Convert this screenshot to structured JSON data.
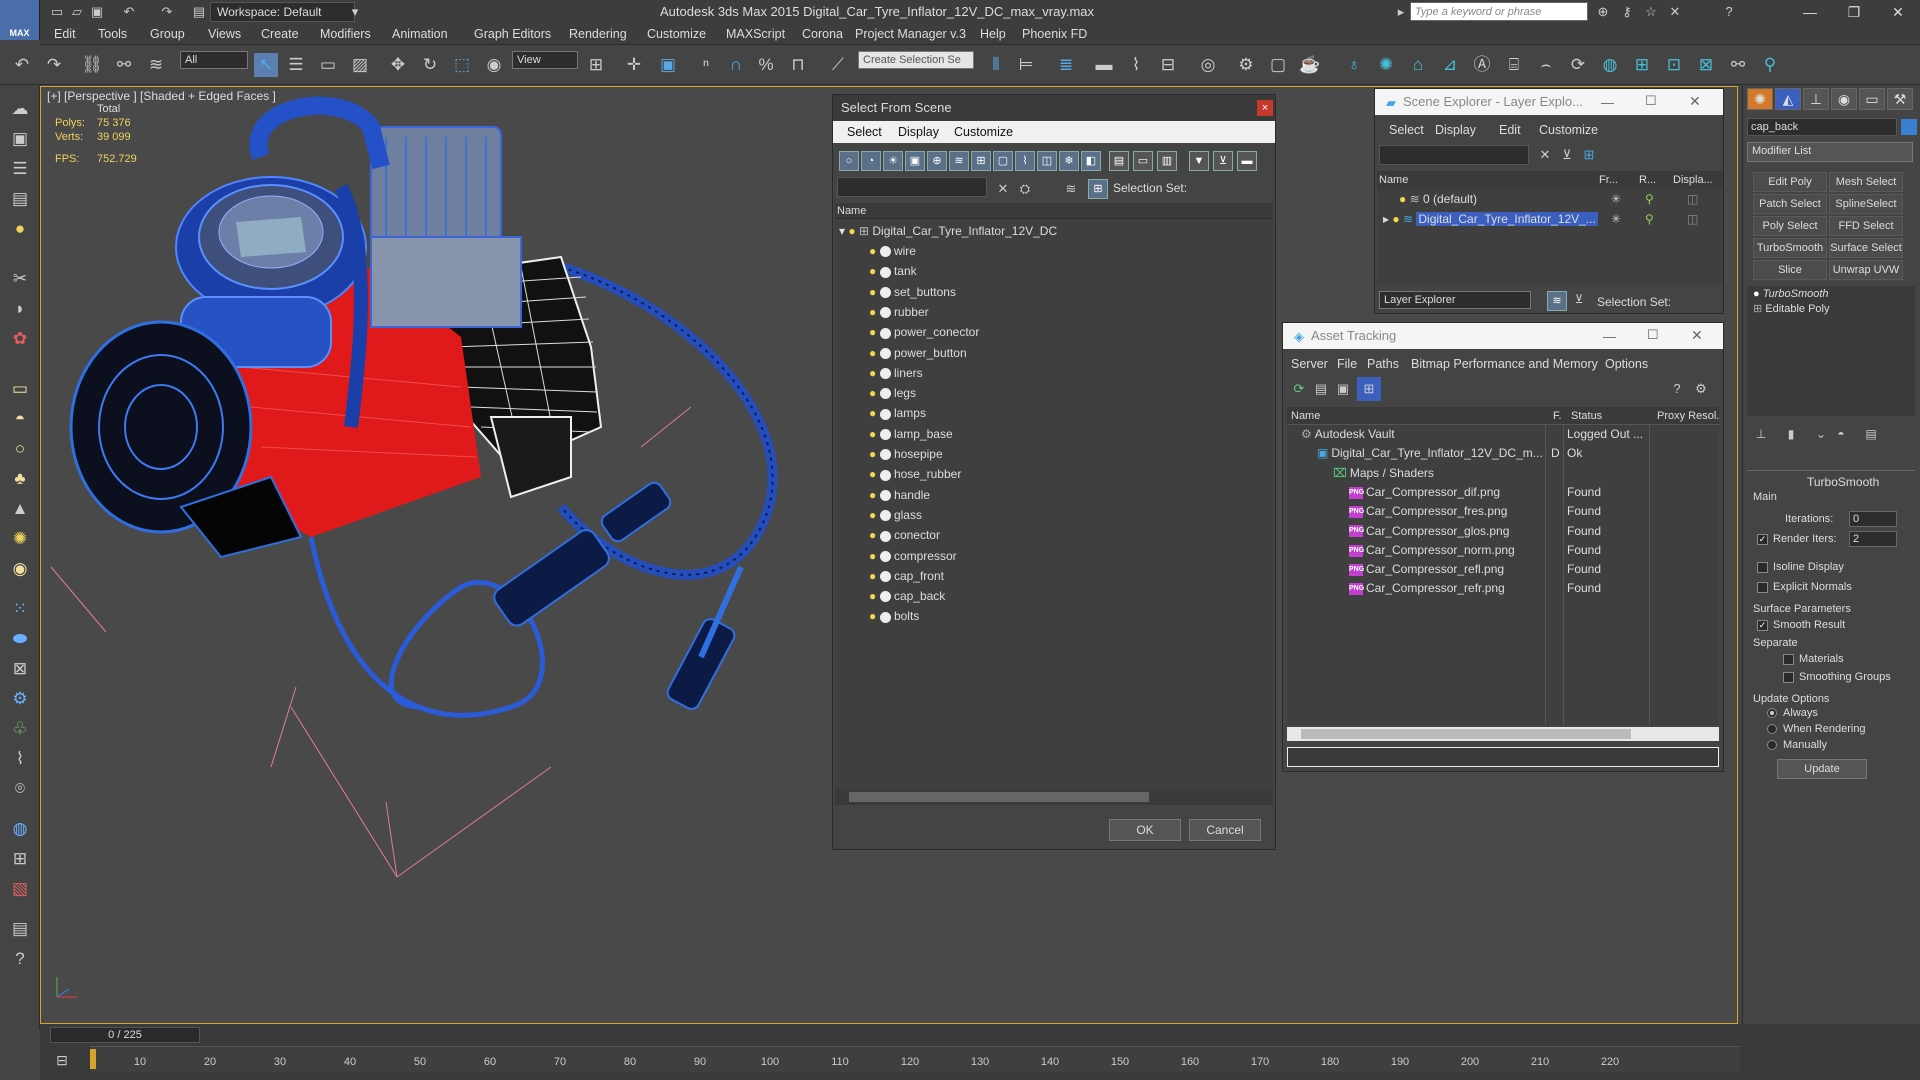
{
  "titlebar": {
    "logo": "MAX",
    "workspace": "Workspace: Default",
    "title": "Autodesk 3ds Max  2015     Digital_Car_Tyre_Inflator_12V_DC_max_vray.max",
    "search_placeholder": "Type a keyword or phrase"
  },
  "menu": [
    "Edit",
    "Tools",
    "Group",
    "Views",
    "Create",
    "Modifiers",
    "Animation",
    "Graph Editors",
    "Rendering",
    "Customize",
    "MAXScript",
    "Corona",
    "Project Manager v.3",
    "Help",
    "Phoenix FD"
  ],
  "toolbar": {
    "filter": "All",
    "refcoord": "View",
    "selection_set": "Create Selection Se"
  },
  "viewport": {
    "label": "[+] [Perspective ] [Shaded + Edged Faces ]",
    "total_label": "Total",
    "polys_label": "Polys:",
    "polys_value": "75 376",
    "verts_label": "Verts:",
    "verts_value": "39 099",
    "fps_label": "FPS:",
    "fps_value": "752.729"
  },
  "timeline": {
    "frame": "0 / 225",
    "ticks": [
      "10",
      "20",
      "30",
      "40",
      "50",
      "60",
      "70",
      "80",
      "90",
      "100",
      "110",
      "120",
      "130",
      "140",
      "150",
      "160",
      "170",
      "180",
      "190",
      "200",
      "210",
      "220"
    ]
  },
  "select_from_scene": {
    "title": "Select From Scene",
    "menu": [
      "Select",
      "Display",
      "Customize"
    ],
    "selection_set_label": "Selection Set:",
    "column_name": "Name",
    "root": "Digital_Car_Tyre_Inflator_12V_DC",
    "items": [
      "wire",
      "tank",
      "set_buttons",
      "rubber",
      "power_conector",
      "power_button",
      "liners",
      "legs",
      "lamps",
      "lamp_base",
      "hosepipe",
      "hose_rubber",
      "handle",
      "glass",
      "conector",
      "compressor",
      "cap_front",
      "cap_back",
      "bolts"
    ],
    "ok": "OK",
    "cancel": "Cancel"
  },
  "scene_explorer": {
    "title": "Scene Explorer - Layer Explo...",
    "menu": [
      "Select",
      "Display",
      "Edit",
      "Customize"
    ],
    "columns": [
      "Name",
      "Fr...",
      "R...",
      "Displa..."
    ],
    "rows": [
      "0 (default)",
      "Digital_Car_Tyre_Inflator_12V_..."
    ],
    "footer_dropdown": "Layer Explorer",
    "selection_set_label": "Selection Set:"
  },
  "asset_tracking": {
    "title": "Asset Tracking",
    "menu": [
      "Server",
      "File",
      "Paths",
      "Bitmap Performance and Memory",
      "Options"
    ],
    "columns": [
      "Name",
      "F.",
      "Status",
      "Proxy Resol."
    ],
    "rows": [
      {
        "name": "Autodesk Vault",
        "f": "",
        "status": "Logged Out ...",
        "indent": 0,
        "kind": "vault"
      },
      {
        "name": "Digital_Car_Tyre_Inflator_12V_DC_m...",
        "f": "D",
        "status": "Ok",
        "indent": 1,
        "kind": "file"
      },
      {
        "name": "Maps / Shaders",
        "f": "",
        "status": "",
        "indent": 2,
        "kind": "folder"
      },
      {
        "name": "Car_Compressor_dif.png",
        "f": "",
        "status": "Found",
        "indent": 3,
        "kind": "png"
      },
      {
        "name": "Car_Compressor_fres.png",
        "f": "",
        "status": "Found",
        "indent": 3,
        "kind": "png"
      },
      {
        "name": "Car_Compressor_glos.png",
        "f": "",
        "status": "Found",
        "indent": 3,
        "kind": "png"
      },
      {
        "name": "Car_Compressor_norm.png",
        "f": "",
        "status": "Found",
        "indent": 3,
        "kind": "png"
      },
      {
        "name": "Car_Compressor_refl.png",
        "f": "",
        "status": "Found",
        "indent": 3,
        "kind": "png"
      },
      {
        "name": "Car_Compressor_refr.png",
        "f": "",
        "status": "Found",
        "indent": 3,
        "kind": "png"
      }
    ],
    "png_badge": "PNG"
  },
  "command_panel": {
    "object_name": "cap_back",
    "modifier_list": "Modifier List",
    "modifier_buttons": [
      "Edit Poly",
      "Mesh Select",
      "Patch Select",
      "SplineSelect",
      "Poly Select",
      "FFD Select",
      "TurboSmooth",
      "Surface Select",
      "Slice",
      "Unwrap UVW"
    ],
    "stack": [
      "TurboSmooth",
      "Editable Poly"
    ],
    "turbosmooth": {
      "header": "TurboSmooth",
      "main": "Main",
      "iterations_label": "Iterations:",
      "iterations": "0",
      "render_iters_label": "Render Iters:",
      "render_iters": "2",
      "isoline": "Isoline Display",
      "explicit_normals": "Explicit Normals",
      "surface_params": "Surface Parameters",
      "smooth_result": "Smooth Result",
      "separate": "Separate",
      "materials": "Materials",
      "smoothing_groups": "Smoothing Groups",
      "update_options": "Update Options",
      "always": "Always",
      "when_rendering": "When Rendering",
      "manually": "Manually",
      "update": "Update"
    }
  },
  "colors": {
    "accent": "#4a6ea9",
    "selection": "#3b5fbf",
    "viewport_border": "#d4a52a",
    "object_red": "#e01a1a",
    "wire_blue": "#2f6fe0"
  }
}
